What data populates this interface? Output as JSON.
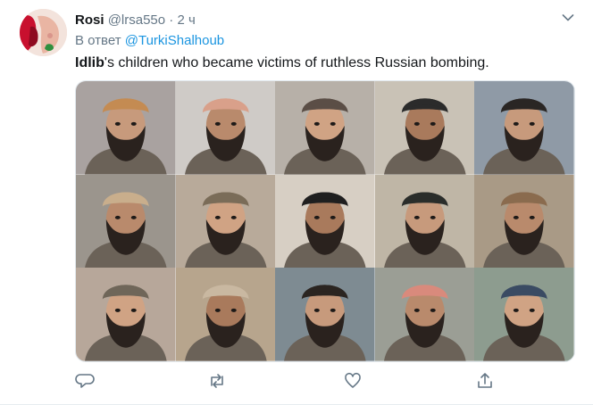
{
  "tweet": {
    "author_name": "Rosi",
    "author_handle": "@lrsa55o",
    "separator": "·",
    "time": "2 ч",
    "reply_prefix": "В ответ",
    "reply_mention": "@TurkiShalhoub",
    "text_tag": "Idlib",
    "text_rest": "'s children who became victims of ruthless Russian bombing."
  },
  "media": {
    "photo_backgrounds": [
      "#a9a2a0",
      "#cfcbc7",
      "#b7b0a8",
      "#c9c2b6",
      "#8f9aa6",
      "#9b958d",
      "#b8aa9a",
      "#d7cfc4",
      "#bfb6a6",
      "#a99a86",
      "#b7a79a",
      "#b7a58d",
      "#7e8b92",
      "#9b9e95",
      "#8d9c8f"
    ],
    "headwear": [
      "#c48b52",
      "#d9a08a",
      "#5b4e46",
      "#2b2b2b",
      "#2a2624",
      "#c9ae8c",
      "#7a6c58",
      "#1f1f1f",
      "#2a2d2a",
      "#8a6b4e",
      "#6f6659",
      "#c9b8a1",
      "#2b2521",
      "#d98a7c",
      "#3a4b63"
    ]
  },
  "icons": {
    "caret": "chevron-down-icon",
    "reply": "reply-icon",
    "retweet": "retweet-icon",
    "like": "heart-icon",
    "share": "share-icon"
  },
  "colors": {
    "accent": "#1b95e0",
    "secondary_text": "#657786",
    "primary_text": "#14171a"
  }
}
